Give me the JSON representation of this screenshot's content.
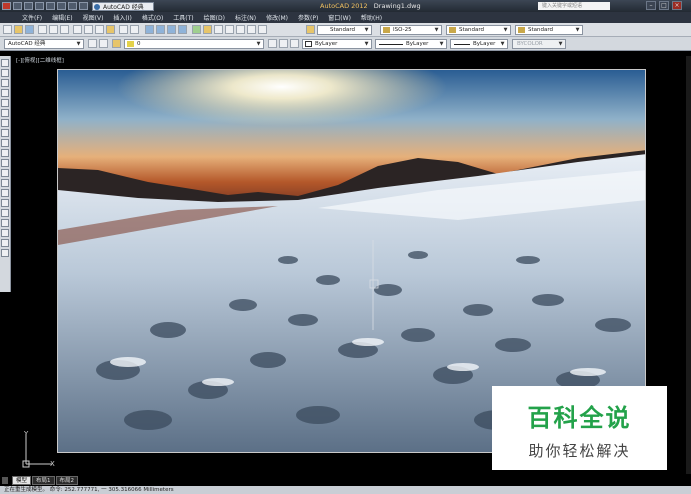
{
  "title_bar": {
    "workspace": "AutoCAD 经典",
    "app_name": "AutoCAD 2012",
    "document": "Drawing1.dwg",
    "search_placeholder": "键入关键字或短语",
    "min": "–",
    "max": "□",
    "close": "×"
  },
  "menu": {
    "items": [
      "文件(F)",
      "编辑(E)",
      "视图(V)",
      "插入(I)",
      "格式(O)",
      "工具(T)",
      "绘图(D)",
      "标注(N)",
      "修改(M)",
      "参数(P)",
      "窗口(W)",
      "帮助(H)"
    ]
  },
  "toolbar1": {
    "text_style": "Standard",
    "dim_style": "ISO-25",
    "table_style": "Standard",
    "mleader_style": "Standard"
  },
  "toolbar2": {
    "workspace": "AutoCAD 经典",
    "layer": "0",
    "color": "ByLayer",
    "linetype": "ByLayer",
    "lineweight": "ByLayer",
    "plotstyle": "BYCOLOR"
  },
  "viewport": {
    "label": "[-][俯视][二维线框]"
  },
  "ucs": {
    "y_label": "Y",
    "x_label": "X"
  },
  "tabs": [
    "模型",
    "布局1",
    "布局2"
  ],
  "status": {
    "text": "正在重生成模型。  命令: 252.777771, 一 305.316066  Millimeters"
  },
  "watermark": {
    "title": "百科全说",
    "subtitle": "助你轻松解决"
  },
  "colors": {
    "title_accent": "#f0c060",
    "watermark_green": "#23a24a"
  }
}
